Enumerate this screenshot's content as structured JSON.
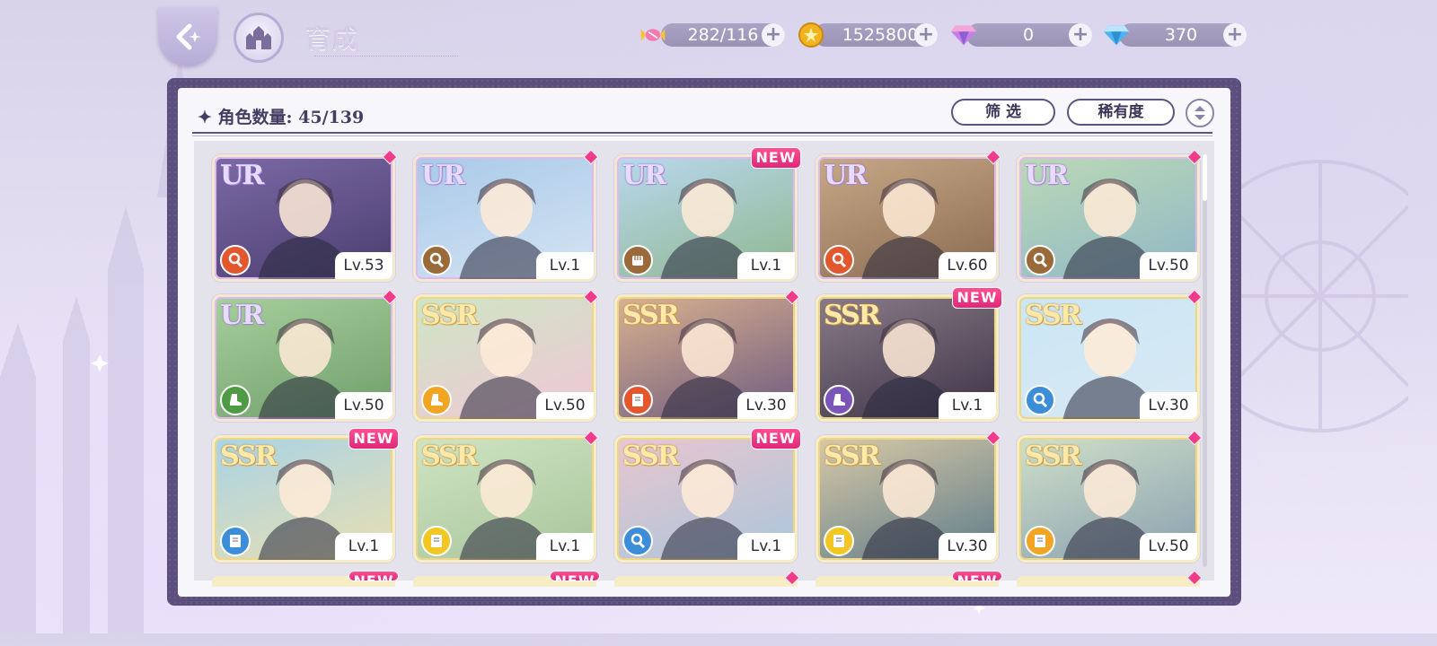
{
  "header": {
    "title": "育成",
    "resources": [
      {
        "icon": "candy-icon",
        "value": "282/116"
      },
      {
        "icon": "gold-coin-icon",
        "value": "1525800"
      },
      {
        "icon": "pink-diamond-icon",
        "value": "0"
      },
      {
        "icon": "blue-diamond-icon",
        "value": "370"
      }
    ],
    "plus_label": "+"
  },
  "panel": {
    "count_label": "✦ 角色数量: 45/139",
    "filter_label": "筛 选",
    "sort_label": "稀有度"
  },
  "cards": [
    {
      "rarity": "UR",
      "level": "Lv.53",
      "attr_color": "#e3572f",
      "attr_icon": "magnifier-icon",
      "new": false,
      "bg": [
        "#7b6aa6",
        "#4a3d6e"
      ]
    },
    {
      "rarity": "UR",
      "level": "Lv.1",
      "attr_color": "#9a6a3a",
      "attr_icon": "magnifier-icon",
      "new": false,
      "bg": [
        "#a9c9e8",
        "#d5e4f3"
      ]
    },
    {
      "rarity": "UR",
      "level": "Lv.1",
      "attr_color": "#9a6a3a",
      "attr_icon": "fist-icon",
      "new": true,
      "bg": [
        "#b9d8ee",
        "#8fb68e"
      ]
    },
    {
      "rarity": "UR",
      "level": "Lv.60",
      "attr_color": "#e3572f",
      "attr_icon": "magnifier-icon",
      "new": false,
      "bg": [
        "#c7a989",
        "#8a6a4f"
      ]
    },
    {
      "rarity": "UR",
      "level": "Lv.50",
      "attr_color": "#9a6a3a",
      "attr_icon": "magnifier-icon",
      "new": false,
      "bg": [
        "#bcd9b6",
        "#8fb7c6"
      ]
    },
    {
      "rarity": "UR",
      "level": "Lv.50",
      "attr_color": "#4e9a45",
      "attr_icon": "boot-icon",
      "new": false,
      "bg": [
        "#a7cf9c",
        "#6f9e6a"
      ]
    },
    {
      "rarity": "SSR",
      "level": "Lv.50",
      "attr_color": "#f2a423",
      "attr_icon": "boot-icon",
      "new": false,
      "bg": [
        "#cde6c4",
        "#f1c6d6"
      ]
    },
    {
      "rarity": "SSR",
      "level": "Lv.30",
      "attr_color": "#e3572f",
      "attr_icon": "book-icon",
      "new": false,
      "bg": [
        "#d9b28f",
        "#6e5a7f"
      ]
    },
    {
      "rarity": "SSR",
      "level": "Lv.1",
      "attr_color": "#7b56b8",
      "attr_icon": "boot-icon",
      "new": true,
      "bg": [
        "#8a7b88",
        "#3d3346"
      ]
    },
    {
      "rarity": "SSR",
      "level": "Lv.30",
      "attr_color": "#3d8ed8",
      "attr_icon": "magnifier-icon",
      "new": false,
      "bg": [
        "#cbe6f3",
        "#d8e9f5"
      ]
    },
    {
      "rarity": "SSR",
      "level": "Lv.1",
      "attr_color": "#3d8ed8",
      "attr_icon": "book-icon",
      "new": true,
      "bg": [
        "#a9d3e6",
        "#e9dfb0"
      ]
    },
    {
      "rarity": "SSR",
      "level": "Lv.1",
      "attr_color": "#f2c623",
      "attr_icon": "book-icon",
      "new": false,
      "bg": [
        "#cfe4c3",
        "#a8c59c"
      ]
    },
    {
      "rarity": "SSR",
      "level": "Lv.1",
      "attr_color": "#3d8ed8",
      "attr_icon": "magnifier-icon",
      "new": true,
      "bg": [
        "#e9c6cf",
        "#a9c6da"
      ]
    },
    {
      "rarity": "SSR",
      "level": "Lv.30",
      "attr_color": "#f2c623",
      "attr_icon": "book-icon",
      "new": false,
      "bg": [
        "#d8c9a6",
        "#5f7c8a"
      ]
    },
    {
      "rarity": "SSR",
      "level": "Lv.50",
      "attr_color": "#f2a423",
      "attr_icon": "book-icon",
      "new": false,
      "bg": [
        "#cfe0c8",
        "#8a9fb0"
      ]
    }
  ],
  "peek_row": [
    {
      "new": true
    },
    {
      "new": true
    },
    {
      "new": false
    },
    {
      "new": true
    },
    {
      "new": false
    }
  ],
  "new_label": "NEW"
}
